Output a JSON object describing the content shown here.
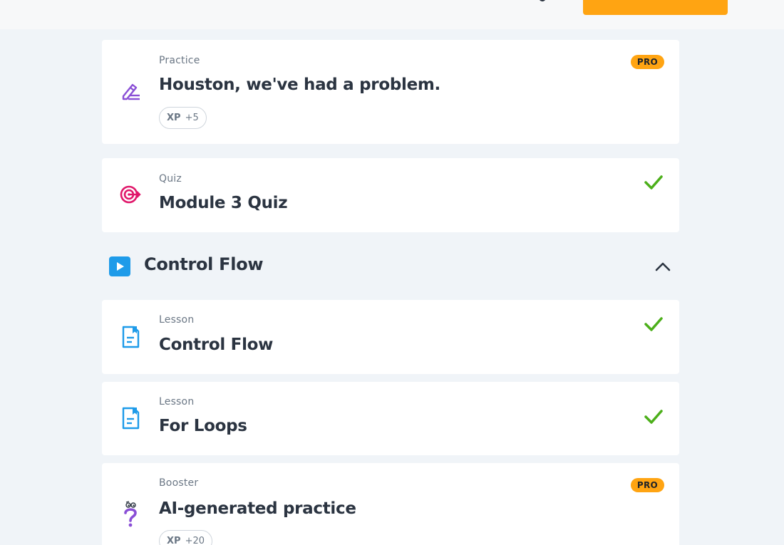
{
  "header": {},
  "cards": [
    {
      "kind": "Practice",
      "title": "Houston, we've had a problem.",
      "icon": "practice-pencil-icon",
      "badge": "PRO",
      "xp_label": "XP",
      "xp_value": "+5"
    },
    {
      "kind": "Quiz",
      "title": "Module 3 Quiz",
      "icon": "quiz-target-icon",
      "status": "completed"
    },
    {
      "kind": "Lesson",
      "title": "Control Flow",
      "icon": "lesson-document-icon",
      "status": "completed"
    },
    {
      "kind": "Lesson",
      "title": "For Loops",
      "icon": "lesson-document-icon",
      "status": "completed"
    },
    {
      "kind": "Booster",
      "title": "AI-generated practice",
      "icon": "booster-question-icon",
      "badge": "PRO",
      "xp_label": "XP",
      "xp_value": "+20"
    }
  ],
  "section": {
    "title": "Control Flow",
    "icon": "play-icon",
    "state": "expanded"
  },
  "colors": {
    "accent": "#ffa412",
    "check": "#4caf1a",
    "practice": "#8a4fd6",
    "quiz": "#e0176a",
    "lesson": "#1e9be9"
  }
}
